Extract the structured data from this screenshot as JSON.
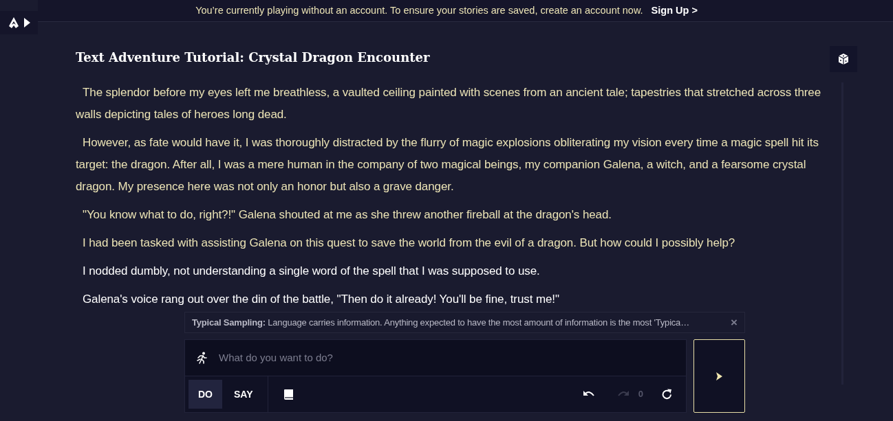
{
  "banner": {
    "message": "You’re currently playing without an account. To ensure your stories are saved, create an account now.",
    "link": "Sign Up >"
  },
  "sidebar": {
    "expanded": false
  },
  "story": {
    "title": "Text Adventure Tutorial: Crystal Dragon Encounter",
    "paragraphs": [
      {
        "kind": "story",
        "text": "The splendor before my eyes left me breathless, a vaulted ceiling painted with scenes from an ancient tale; tapestries that stretched across three walls depicting tales of heroes long dead."
      },
      {
        "kind": "story",
        "text": "However, as fate would have it, I was thoroughly distracted by the flurry of magic explosions obliterating my vision every time a magic spell hit its target: the dragon. After all, I was a mere human in the company of two magical beings, my companion Galena, a witch, and a fearsome crystal dragon. My presence here was not only an honor but also a grave danger."
      },
      {
        "kind": "story",
        "text": "\"You know what to do, right?!\" Galena shouted at me as she threw another fireball at the dragon's head."
      },
      {
        "kind": "story",
        "text": "I had been tasked with assisting Galena on this quest to save the world from the evil of a dragon. But how could I possibly help?"
      },
      {
        "kind": "action",
        "text": "I nodded dumbly, not understanding a single word of the spell that I was supposed to use."
      },
      {
        "kind": "action",
        "text": "Galena's voice rang out over the din of the battle, \"Then do it already! You'll be fine, trust me!\""
      }
    ]
  },
  "tip": {
    "text": "**Typical Sampling:** Language carries information. Anything expected to have the most amount of information is the most 'Typica…",
    "close": "×"
  },
  "input": {
    "placeholder": "What do you want to do?"
  },
  "modes": [
    {
      "label": "DO",
      "selected": true
    },
    {
      "label": "SAY",
      "selected": false
    }
  ],
  "redo": {
    "count": "0",
    "disabled": true
  }
}
